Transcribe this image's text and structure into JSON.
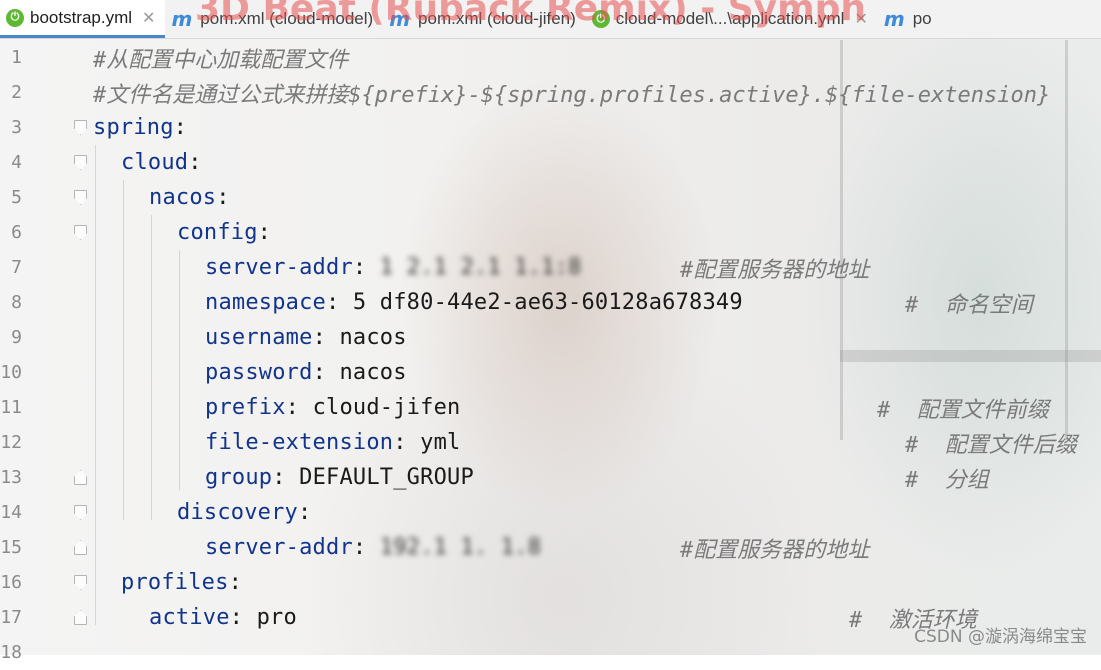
{
  "tabs": [
    {
      "label": "bootstrap.yml",
      "icon": "spring-leaf-icon",
      "active": true,
      "closable": true
    },
    {
      "label": "pom.xml (cloud-model)",
      "icon": "maven-icon",
      "active": false,
      "closable": false
    },
    {
      "label": "pom.xml (cloud-jifen)",
      "icon": "maven-icon",
      "active": false,
      "closable": false
    },
    {
      "label": "cloud-model\\...\\application.yml",
      "icon": "spring-leaf-icon",
      "active": false,
      "closable": true
    },
    {
      "label": "po",
      "icon": "maven-icon",
      "active": false,
      "closable": false
    }
  ],
  "overlay_text": "3D Beat (Ruback Remix) - Symph",
  "editor": {
    "lines": [
      {
        "n": "1",
        "comment": "#从配置中心加载配置文件"
      },
      {
        "n": "2",
        "comment": "#文件名是通过公式来拼接${prefix}-${spring.profiles.active}.${file-extension}"
      },
      {
        "n": "3",
        "key": "spring",
        "value": "",
        "comment": ""
      },
      {
        "n": "4",
        "key": "cloud",
        "value": "",
        "comment": ""
      },
      {
        "n": "5",
        "key": "nacos",
        "value": "",
        "comment": ""
      },
      {
        "n": "6",
        "key": "config",
        "value": "",
        "comment": ""
      },
      {
        "n": "7",
        "key": "server-addr",
        "value": "1 2.1 2.1 1.1:8",
        "comment": "#配置服务器的地址"
      },
      {
        "n": "8",
        "key": "namespace",
        "value": "5 df80-44e2-ae63-60128a678349",
        "comment": "#  命名空间"
      },
      {
        "n": "9",
        "key": "username",
        "value": "nacos",
        "comment": ""
      },
      {
        "n": "10",
        "key": "password",
        "value": "nacos",
        "comment": ""
      },
      {
        "n": "11",
        "key": "prefix",
        "value": "cloud-jifen",
        "comment": "#  配置文件前缀"
      },
      {
        "n": "12",
        "key": "file-extension",
        "value": "yml",
        "comment": "#  配置文件后缀"
      },
      {
        "n": "13",
        "key": "group",
        "value": "DEFAULT_GROUP",
        "comment": "#  分组"
      },
      {
        "n": "14",
        "key": "discovery",
        "value": "",
        "comment": ""
      },
      {
        "n": "15",
        "key": "server-addr",
        "value": "192.1 1. 1.8",
        "comment": "#配置服务器的地址"
      },
      {
        "n": "16",
        "key": "profiles",
        "value": "",
        "comment": ""
      },
      {
        "n": "17",
        "key": "active",
        "value": "pro",
        "comment": "#  激活环境"
      },
      {
        "n": "18",
        "key": "",
        "value": "",
        "comment": ""
      }
    ]
  },
  "watermark": "CSDN @漩涡海绵宝宝"
}
